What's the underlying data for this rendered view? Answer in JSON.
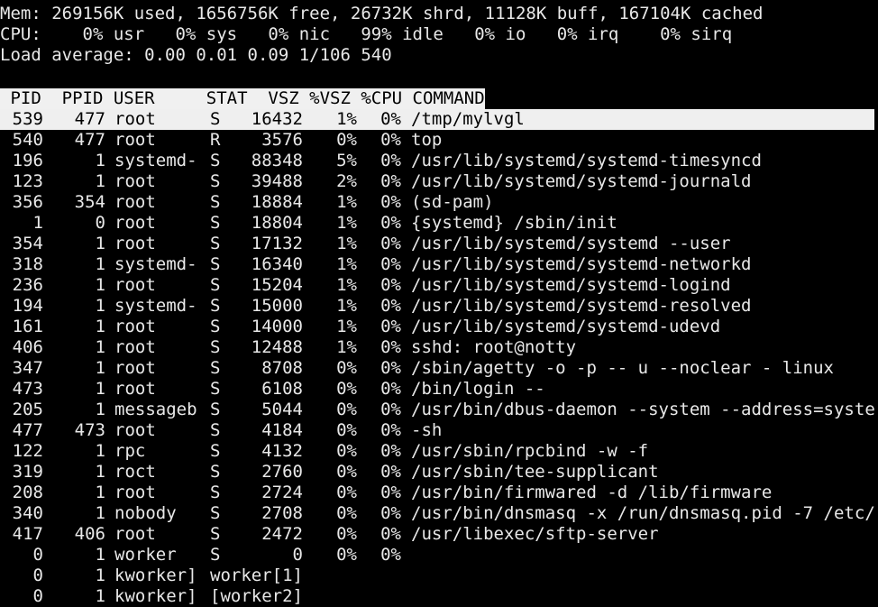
{
  "summary": {
    "mem": "Mem: 269156K used, 1656756K free, 26732K shrd, 11128K buff, 167104K cached",
    "cpu": "CPU:    0% usr   0% sys   0% nic   99% idle   0% io   0% irq    0% sirq",
    "load": "Load average: 0.00 0.01 0.09 1/106 540"
  },
  "table": {
    "header": " PID  PPID USER     STAT  VSZ %VSZ %CPU COMMAND",
    "rows": [
      {
        "pid": "539",
        "ppid": "477",
        "user": "root",
        "stat": "S",
        "vsz": "16432",
        "pvsz": "1%",
        "pcpu": "0%",
        "cmd": "/tmp/mylvgl",
        "selected": true
      },
      {
        "pid": "540",
        "ppid": "477",
        "user": "root",
        "stat": "R",
        "vsz": "3576",
        "pvsz": "0%",
        "pcpu": "0%",
        "cmd": "top"
      },
      {
        "pid": "196",
        "ppid": "1",
        "user": "systemd-",
        "stat": "S",
        "vsz": "88348",
        "pvsz": "5%",
        "pcpu": "0%",
        "cmd": "/usr/lib/systemd/systemd-timesyncd"
      },
      {
        "pid": "123",
        "ppid": "1",
        "user": "root",
        "stat": "S",
        "vsz": "39488",
        "pvsz": "2%",
        "pcpu": "0%",
        "cmd": "/usr/lib/systemd/systemd-journald"
      },
      {
        "pid": "356",
        "ppid": "354",
        "user": "root",
        "stat": "S",
        "vsz": "18884",
        "pvsz": "1%",
        "pcpu": "0%",
        "cmd": "(sd-pam)"
      },
      {
        "pid": "1",
        "ppid": "0",
        "user": "root",
        "stat": "S",
        "vsz": "18804",
        "pvsz": "1%",
        "pcpu": "0%",
        "cmd": "{systemd} /sbin/init"
      },
      {
        "pid": "354",
        "ppid": "1",
        "user": "root",
        "stat": "S",
        "vsz": "17132",
        "pvsz": "1%",
        "pcpu": "0%",
        "cmd": "/usr/lib/systemd/systemd --user"
      },
      {
        "pid": "318",
        "ppid": "1",
        "user": "systemd-",
        "stat": "S",
        "vsz": "16340",
        "pvsz": "1%",
        "pcpu": "0%",
        "cmd": "/usr/lib/systemd/systemd-networkd"
      },
      {
        "pid": "236",
        "ppid": "1",
        "user": "root",
        "stat": "S",
        "vsz": "15204",
        "pvsz": "1%",
        "pcpu": "0%",
        "cmd": "/usr/lib/systemd/systemd-logind"
      },
      {
        "pid": "194",
        "ppid": "1",
        "user": "systemd-",
        "stat": "S",
        "vsz": "15000",
        "pvsz": "1%",
        "pcpu": "0%",
        "cmd": "/usr/lib/systemd/systemd-resolved"
      },
      {
        "pid": "161",
        "ppid": "1",
        "user": "root",
        "stat": "S",
        "vsz": "14000",
        "pvsz": "1%",
        "pcpu": "0%",
        "cmd": "/usr/lib/systemd/systemd-udevd"
      },
      {
        "pid": "406",
        "ppid": "1",
        "user": "root",
        "stat": "S",
        "vsz": "12488",
        "pvsz": "1%",
        "pcpu": "0%",
        "cmd": "sshd: root@notty"
      },
      {
        "pid": "347",
        "ppid": "1",
        "user": "root",
        "stat": "S",
        "vsz": "8708",
        "pvsz": "0%",
        "pcpu": "0%",
        "cmd": "/sbin/agetty -o -p -- u --noclear - linux"
      },
      {
        "pid": "473",
        "ppid": "1",
        "user": "root",
        "stat": "S",
        "vsz": "6108",
        "pvsz": "0%",
        "pcpu": "0%",
        "cmd": "/bin/login --"
      },
      {
        "pid": "205",
        "ppid": "1",
        "user": "messageb",
        "stat": "S",
        "vsz": "5044",
        "pvsz": "0%",
        "pcpu": "0%",
        "cmd": "/usr/bin/dbus-daemon --system --address=syste"
      },
      {
        "pid": "477",
        "ppid": "473",
        "user": "root",
        "stat": "S",
        "vsz": "4184",
        "pvsz": "0%",
        "pcpu": "0%",
        "cmd": "-sh"
      },
      {
        "pid": "122",
        "ppid": "1",
        "user": "rpc",
        "stat": "S",
        "vsz": "4132",
        "pvsz": "0%",
        "pcpu": "0%",
        "cmd": "/usr/sbin/rpcbind -w -f"
      },
      {
        "pid": "319",
        "ppid": "1",
        "user": "roct",
        "stat": "S",
        "vsz": "2760",
        "pvsz": "0%",
        "pcpu": "0%",
        "cmd": "/usr/sbin/tee-supplicant"
      },
      {
        "pid": "208",
        "ppid": "1",
        "user": "root",
        "stat": "S",
        "vsz": "2724",
        "pvsz": "0%",
        "pcpu": "0%",
        "cmd": "/usr/bin/firmwared -d /lib/firmware"
      },
      {
        "pid": "340",
        "ppid": "1",
        "user": "nobody",
        "stat": "S",
        "vsz": "2708",
        "pvsz": "0%",
        "pcpu": "0%",
        "cmd": "/usr/bin/dnsmasq -x /run/dnsmasq.pid -7 /etc/"
      },
      {
        "pid": "417",
        "ppid": "406",
        "user": "root",
        "stat": "S",
        "vsz": "2472",
        "pvsz": "0%",
        "pcpu": "0%",
        "cmd": "/usr/libexec/sftp-server"
      },
      {
        "pid": "0",
        "ppid": "1",
        "user": "worker",
        "stat": "S",
        "vsz": "0",
        "pvsz": "0%",
        "pcpu": "0%",
        "cmd": ""
      },
      {
        "pid": "0",
        "ppid": "1",
        "user": "kworker]",
        "stat": "worker[1]",
        "vsz": "",
        "pvsz": "",
        "pcpu": "",
        "cmd": ""
      },
      {
        "pid": "0",
        "ppid": "1",
        "user": "kworker]",
        "stat": "[worker2]",
        "vsz": "",
        "pvsz": "",
        "pcpu": "",
        "cmd": ""
      }
    ]
  },
  "colors": {
    "background": "#000000",
    "foreground": "#e8e8e8",
    "highlight": "#efefef"
  }
}
